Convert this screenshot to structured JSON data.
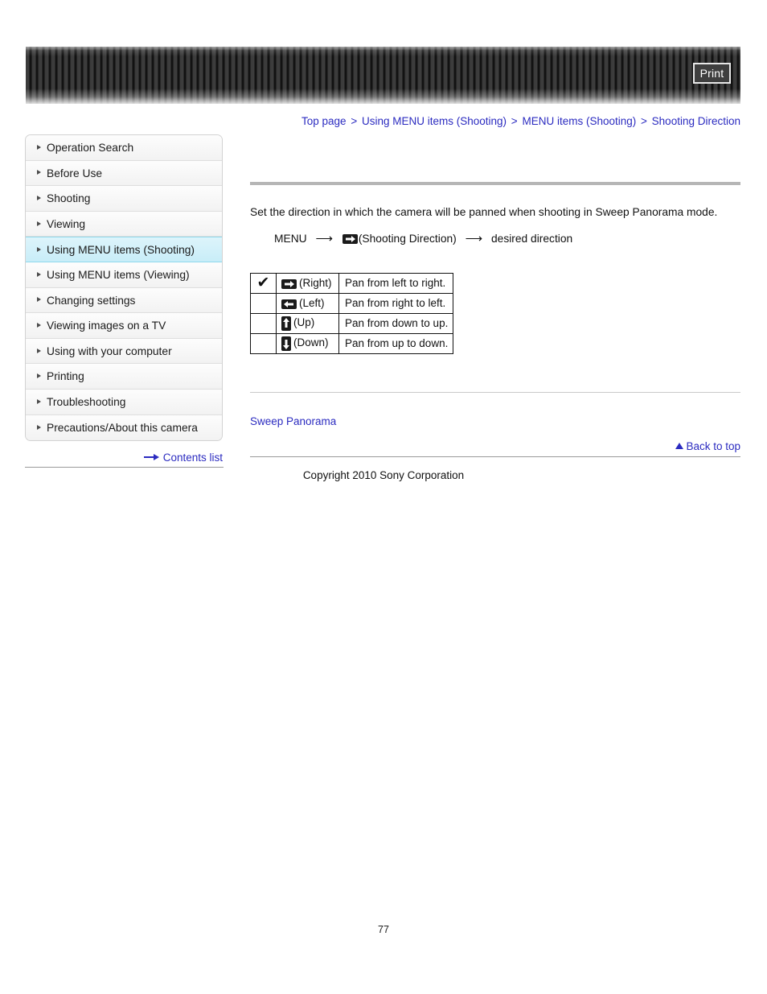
{
  "header": {
    "print_label": "Print",
    "banner_icon": "striped-banner"
  },
  "breadcrumb": {
    "separator": ">",
    "items": [
      {
        "label": "Top page"
      },
      {
        "label": "Using MENU items (Shooting)"
      },
      {
        "label": "MENU items (Shooting)"
      },
      {
        "label": "Shooting Direction"
      }
    ]
  },
  "sidebar": {
    "items": [
      {
        "label": "Operation Search",
        "active": false
      },
      {
        "label": "Before Use",
        "active": false
      },
      {
        "label": "Shooting",
        "active": false
      },
      {
        "label": "Viewing",
        "active": false
      },
      {
        "label": "Using MENU items (Shooting)",
        "active": true
      },
      {
        "label": "Using MENU items (Viewing)",
        "active": false
      },
      {
        "label": "Changing settings",
        "active": false
      },
      {
        "label": "Viewing images on a TV",
        "active": false
      },
      {
        "label": "Using with your computer",
        "active": false
      },
      {
        "label": "Printing",
        "active": false
      },
      {
        "label": "Troubleshooting",
        "active": false
      },
      {
        "label": "Precautions/About this camera",
        "active": false
      }
    ],
    "contents_list_label": "Contents list",
    "contents_list_icon": "right-arrow-icon"
  },
  "main": {
    "intro": "Set the direction in which the camera will be panned when shooting in Sweep Panorama mode.",
    "menu_path": {
      "start": "MENU",
      "arrow": "⟶",
      "setting_name": "(Shooting Direction)",
      "end": "desired direction",
      "setting_icon": "arrow-right-badge-icon"
    },
    "table": {
      "rows": [
        {
          "default": true,
          "check": "✔",
          "icon": "arrow-right-badge-icon",
          "option": "(Right)",
          "description": "Pan from left to right."
        },
        {
          "default": false,
          "check": "",
          "icon": "arrow-left-badge-icon",
          "option": "(Left)",
          "description": "Pan from right to left."
        },
        {
          "default": false,
          "check": "",
          "icon": "arrow-up-badge-icon",
          "option": "(Up)",
          "description": "Pan from down to up."
        },
        {
          "default": false,
          "check": "",
          "icon": "arrow-down-badge-icon",
          "option": "(Down)",
          "description": "Pan from up to down."
        }
      ]
    },
    "related_link": "Sweep Panorama",
    "back_to_top": "Back to top",
    "back_to_top_icon": "triangle-up-icon"
  },
  "footer": {
    "copyright": "Copyright 2010 Sony Corporation",
    "page_number": "77"
  },
  "colors": {
    "link": "#2b2bc0",
    "active_nav_bg": "#c8edf8",
    "active_nav_border": "#8fd8ec",
    "rule_thick": "#b6b6b6",
    "icon_dark": "#1a1a1a"
  }
}
